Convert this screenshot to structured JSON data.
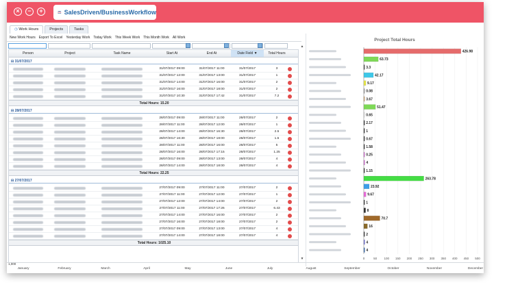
{
  "app": {
    "title": "SalesDriven/BusinessWorkflow"
  },
  "window_controls": {
    "close": "×",
    "minimize": "−",
    "maximize": "+"
  },
  "tabs": [
    "Work Hours",
    "Projects",
    "Tasks"
  ],
  "toolbar": [
    "New Work Hours",
    "Export To Excel",
    "Yesterday Work",
    "Today Work",
    "This Week Work",
    "This Month Work",
    "All Work"
  ],
  "columns": [
    "Person",
    "Project",
    "Task Name",
    "Start At",
    "End At",
    "Date Field",
    "Total Hours"
  ],
  "sort_indicator": "▼",
  "groups": [
    {
      "label": "31/07/2017",
      "total": "Total Hours: 15.20",
      "rows": [
        {
          "start": "31/07/2017 09:00",
          "end": "31/07/2017 11:00",
          "date": "31/07/2017",
          "hours": "3"
        },
        {
          "start": "31/07/2017 12:00",
          "end": "31/07/2017 13:00",
          "date": "31/07/2017",
          "hours": "1"
        },
        {
          "start": "31/07/2017 14:00",
          "end": "31/07/2017 16:00",
          "date": "31/07/2017",
          "hours": "2"
        },
        {
          "start": "31/07/2017 16:00",
          "end": "31/07/2017 18:00",
          "date": "31/07/2017",
          "hours": "2"
        },
        {
          "start": "31/07/2017 10:30",
          "end": "31/07/2017 17:42",
          "date": "31/07/2017",
          "hours": "7.2"
        }
      ]
    },
    {
      "label": "28/07/2017",
      "total": "Total Hours: 22.25",
      "rows": [
        {
          "start": "28/07/2017 09:00",
          "end": "28/07/2017 11:00",
          "date": "28/07/2017",
          "hours": "2"
        },
        {
          "start": "28/07/2017 11:00",
          "end": "28/07/2017 12:00",
          "date": "28/07/2017",
          "hours": "1"
        },
        {
          "start": "28/07/2017 14:00",
          "end": "28/07/2017 16:30",
          "date": "28/07/2017",
          "hours": "2.5"
        },
        {
          "start": "28/07/2017 16:30",
          "end": "28/07/2017 18:00",
          "date": "28/07/2017",
          "hours": "1.5"
        },
        {
          "start": "28/07/2017 11:00",
          "end": "28/07/2017 16:00",
          "date": "28/07/2017",
          "hours": "5"
        },
        {
          "start": "28/07/2017 16:00",
          "end": "28/07/2017 17:15",
          "date": "28/07/2017",
          "hours": "1.25"
        },
        {
          "start": "28/07/2017 09:00",
          "end": "28/07/2017 13:00",
          "date": "28/07/2017",
          "hours": "4"
        },
        {
          "start": "28/07/2017 14:00",
          "end": "28/07/2017 18:00",
          "date": "28/07/2017",
          "hours": "4"
        }
      ]
    },
    {
      "label": "27/07/2017",
      "total": "Total Hours: 1025.10",
      "rows": [
        {
          "start": "27/07/2017 09:00",
          "end": "27/07/2017 11:00",
          "date": "27/07/2017",
          "hours": "2"
        },
        {
          "start": "27/07/2017 11:00",
          "end": "27/07/2017 12:00",
          "date": "27/07/2017",
          "hours": "1"
        },
        {
          "start": "27/07/2017 12:00",
          "end": "27/07/2017 14:00",
          "date": "27/07/2017",
          "hours": "2"
        },
        {
          "start": "27/07/2017 11:00",
          "end": "27/07/2017 17:26",
          "date": "27/07/2017",
          "hours": "6.43"
        },
        {
          "start": "27/07/2017 14:00",
          "end": "27/07/2017 16:00",
          "date": "27/07/2017",
          "hours": "2"
        },
        {
          "start": "27/07/2017 16:00",
          "end": "27/07/2017 18:00",
          "date": "27/07/2017",
          "hours": "2"
        },
        {
          "start": "27/07/2017 09:00",
          "end": "27/07/2017 13:00",
          "date": "27/07/2017",
          "hours": "4"
        },
        {
          "start": "27/07/2017 14:00",
          "end": "27/07/2017 18:00",
          "date": "27/07/2017",
          "hours": "4"
        }
      ]
    }
  ],
  "chart_data": {
    "type": "bar",
    "orientation": "horizontal",
    "title": "Project Total Hours",
    "values": [
      426.98,
      63.73,
      3.3,
      42.17,
      9.17,
      0.08,
      3.67,
      51.47,
      0.65,
      2.17,
      1,
      0.67,
      1.58,
      0.25,
      4,
      1.15,
      263.78,
      23.92,
      9.67,
      1,
      8,
      70.7,
      16,
      2,
      4,
      4
    ],
    "value_labels": [
      "426.98",
      "63.73",
      "3.3",
      "42.17",
      "9.17",
      "0.08",
      "3.67",
      "51.47",
      "0.65",
      "2.17",
      "1",
      "0.67",
      "1.58",
      "0.25",
      "4",
      "1.15",
      "263.78",
      "23.92",
      "9.67",
      "1",
      "8",
      "70.7",
      "16",
      "2",
      "4",
      "4"
    ],
    "colors": [
      "#e56b6b",
      "#7ed957",
      "#444444",
      "#3ec8e8",
      "#e4e44a",
      "#9a9a9a",
      "#c8a070",
      "#7ed957",
      "#dddddd",
      "#333333",
      "#333333",
      "#333333",
      "#333333",
      "#cc66cc",
      "#cc66cc",
      "#333333",
      "#44dd44",
      "#3e9ee8",
      "#e86bd8",
      "#333333",
      "#333333",
      "#a0692a",
      "#8a6a2a",
      "#333333",
      "#6666cc",
      "#3366aa"
    ],
    "xlim": [
      0,
      500
    ],
    "xticks": [
      "0",
      "50",
      "100",
      "150",
      "200",
      "250",
      "300",
      "350",
      "400",
      "450",
      "500"
    ],
    "grid": true
  },
  "timeline": {
    "months": [
      "January",
      "February",
      "March",
      "April",
      "May",
      "June",
      "July",
      "August",
      "September",
      "October",
      "November",
      "December"
    ],
    "value": "1,000"
  }
}
